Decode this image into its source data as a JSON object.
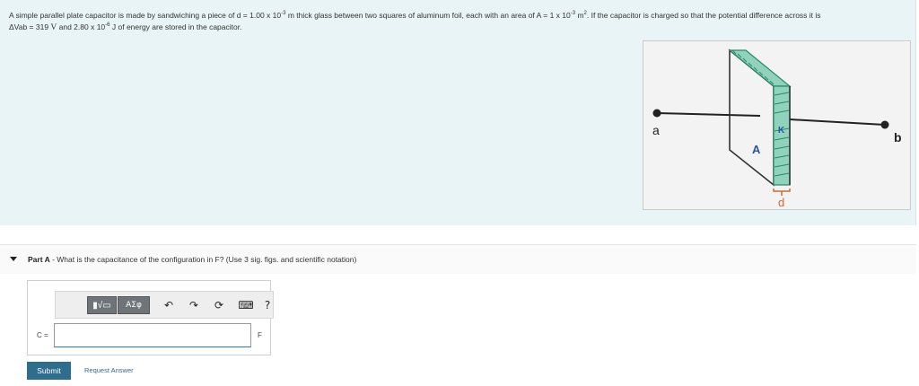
{
  "problem": {
    "text_1": "A simple parallel plate capacitor is made by sandwiching a piece of d = 1.00 x 10",
    "exp_1": "-3",
    "text_2": " m thick glass between two squares of aluminum foil, each with an area of A = 1 x 10",
    "exp_2": "-3",
    "text_3": " m",
    "exp_3": "2",
    "text_4": ". If the capacitor is charged so that the potential difference across it is",
    "text_5": "ΔVab = 319 ",
    "unit_v": "V",
    "text_6": " and 2.80 x 10",
    "exp_4": "-6",
    "text_7": " J of energy are stored in the capacitor."
  },
  "figure": {
    "label_a": "a",
    "label_b": "b",
    "label_area": "A",
    "label_k": "K",
    "label_d": "d"
  },
  "part": {
    "label": "Part A",
    "question": " - What is the capacitance of the configuration in F? (Use 3 sig. figs. and scientific notation)"
  },
  "toolbar": {
    "frac_icon": "▮√▭",
    "greek_label": "ΑΣφ",
    "undo_icon": "↶",
    "redo_icon": "↷",
    "reset_icon": "⟳",
    "keyboard_icon": "⌨",
    "help_icon": "?"
  },
  "answer": {
    "variable_label": "C =",
    "value": "",
    "unit": "F"
  },
  "actions": {
    "submit_label": "Submit",
    "request_label": "Request Answer"
  }
}
